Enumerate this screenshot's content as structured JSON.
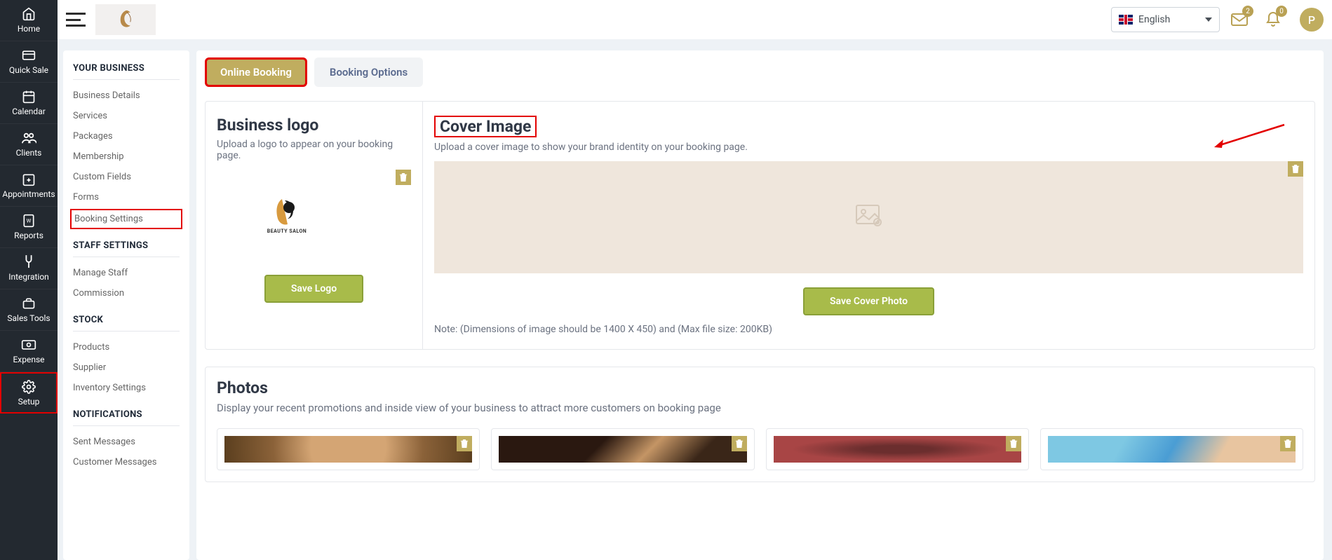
{
  "nav": {
    "items": [
      {
        "label": "Home",
        "icon": "home"
      },
      {
        "label": "Quick Sale",
        "icon": "sale"
      },
      {
        "label": "Calendar",
        "icon": "calendar"
      },
      {
        "label": "Clients",
        "icon": "clients"
      },
      {
        "label": "Appointments",
        "icon": "appointments"
      },
      {
        "label": "Reports",
        "icon": "reports"
      },
      {
        "label": "Integration",
        "icon": "integration"
      },
      {
        "label": "Sales Tools",
        "icon": "tools"
      },
      {
        "label": "Expense",
        "icon": "expense"
      },
      {
        "label": "Setup",
        "icon": "setup"
      }
    ]
  },
  "topbar": {
    "language": "English",
    "notifications_badge": "2",
    "bell_badge": "0",
    "avatar_initial": "P"
  },
  "settings": {
    "group_business": "YOUR BUSINESS",
    "business_items": [
      "Business Details",
      "Services",
      "Packages",
      "Membership",
      "Custom Fields",
      "Forms",
      "Booking Settings"
    ],
    "group_staff": "STAFF SETTINGS",
    "staff_items": [
      "Manage Staff",
      "Commission"
    ],
    "group_stock": "STOCK",
    "stock_items": [
      "Products",
      "Supplier",
      "Inventory Settings"
    ],
    "group_notifications": "NOTIFICATIONS",
    "notification_items": [
      "Sent Messages",
      "Customer Messages"
    ]
  },
  "tabs": {
    "online_booking": "Online Booking",
    "booking_options": "Booking Options"
  },
  "logo_panel": {
    "title": "Business logo",
    "desc": "Upload a logo to appear on your booking page.",
    "logo_text": "BEAUTY SALON",
    "save_btn": "Save Logo"
  },
  "cover_panel": {
    "title": "Cover Image",
    "desc": "Upload a cover image to show your brand identity on your booking page.",
    "save_btn": "Save Cover Photo",
    "note": "Note: (Dimensions of image should be 1400 X 450) and (Max file size: 200KB)"
  },
  "photos": {
    "title": "Photos",
    "desc": "Display your recent promotions and inside view of your business to attract more customers on booking page"
  }
}
